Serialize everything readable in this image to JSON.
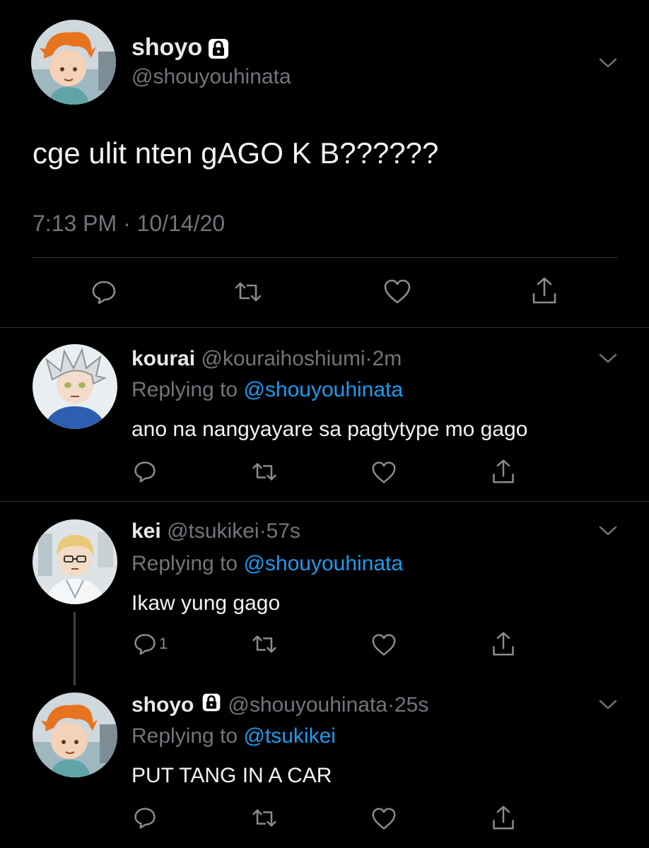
{
  "main_tweet": {
    "display_name": "shoyo",
    "handle": "@shouyouhinata",
    "text": "cge ulit nten gAGO K B??????",
    "time": "7:13 PM",
    "separator": "·",
    "date": "10/14/20"
  },
  "replies": [
    {
      "display_name": "kourai",
      "handle": "@kouraihoshiumi",
      "separator": "·",
      "time_ago": "2m",
      "replying_label": "Replying to",
      "replying_handle": "@shouyouhinata",
      "text": "ano na nangyayare sa pagtytype mo gago",
      "reply_count": ""
    },
    {
      "display_name": "kei",
      "handle": "@tsukikei",
      "separator": "·",
      "time_ago": "57s",
      "replying_label": "Replying to",
      "replying_handle": "@shouyouhinata",
      "text": "Ikaw yung gago",
      "reply_count": "1"
    },
    {
      "display_name": "shoyo",
      "handle": "@shouyouhinata",
      "separator": "·",
      "time_ago": "25s",
      "replying_label": "Replying to",
      "replying_handle": "@tsukikei",
      "text": "PUT TANG IN A CAR",
      "reply_count": ""
    }
  ],
  "icons": {
    "reply": "reply-icon",
    "retweet": "retweet-icon",
    "like": "like-icon",
    "share": "share-icon",
    "more": "chevron-down-icon",
    "protected": "lock-icon"
  },
  "colors": {
    "background": "#000000",
    "text": "#e7e9ea",
    "muted": "#71767b",
    "link": "#1d9bf0",
    "divider": "#2f3336"
  }
}
